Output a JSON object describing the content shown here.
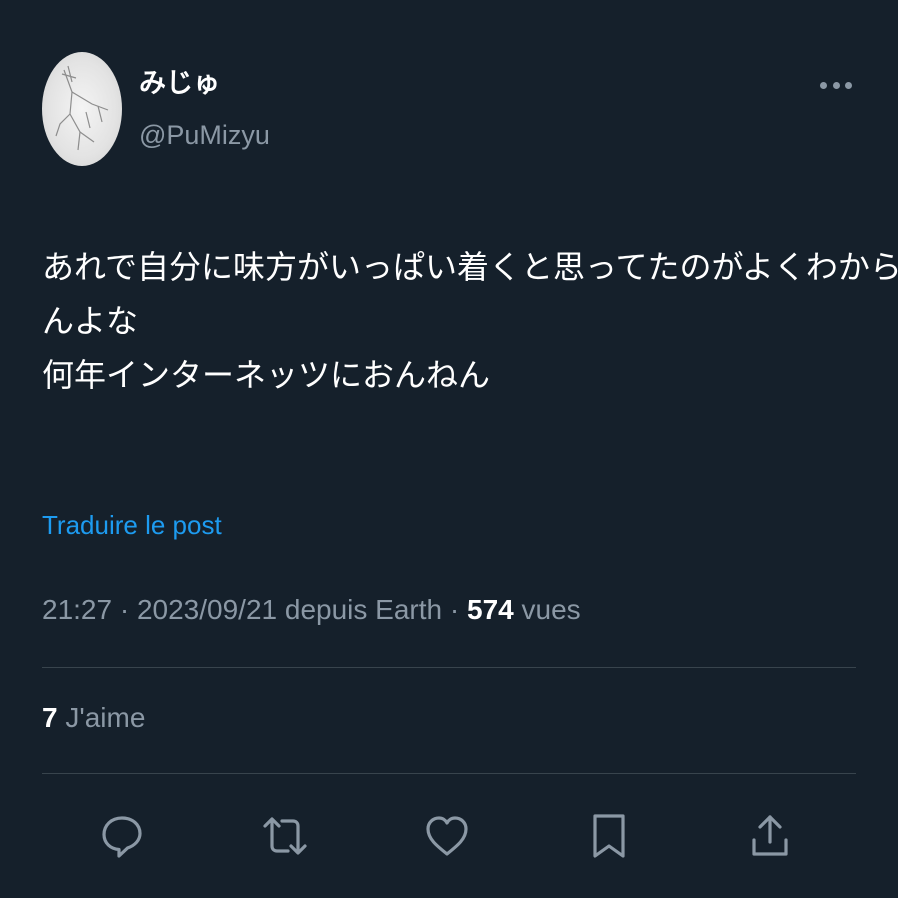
{
  "author": {
    "display_name": "みじゅ",
    "handle": "@PuMizyu"
  },
  "menu": {
    "icon": "more-horizontal-icon"
  },
  "tweet": {
    "lines": [
      "あれで自分に味方がいっぱい着くと思ってたのがよくわから",
      "んよな",
      "何年インターネッツにおんねん"
    ]
  },
  "translate_label": "Traduire le post",
  "meta": {
    "time": "21:27",
    "separator1": " · ",
    "date": "2023/09/21",
    "source": " depuis Earth",
    "separator2": " · ",
    "views_count": "574",
    "views_label": " vues"
  },
  "stats": {
    "likes_count": "7",
    "likes_label": " J'aime"
  },
  "actions": [
    {
      "icon": "reply-icon"
    },
    {
      "icon": "retweet-icon"
    },
    {
      "icon": "like-icon"
    },
    {
      "icon": "bookmark-icon"
    },
    {
      "icon": "share-icon"
    }
  ],
  "colors": {
    "background": "#15202b",
    "text_primary": "#ffffff",
    "text_secondary": "#8b98a5",
    "accent": "#1d9bf0",
    "divider": "#38444d"
  }
}
